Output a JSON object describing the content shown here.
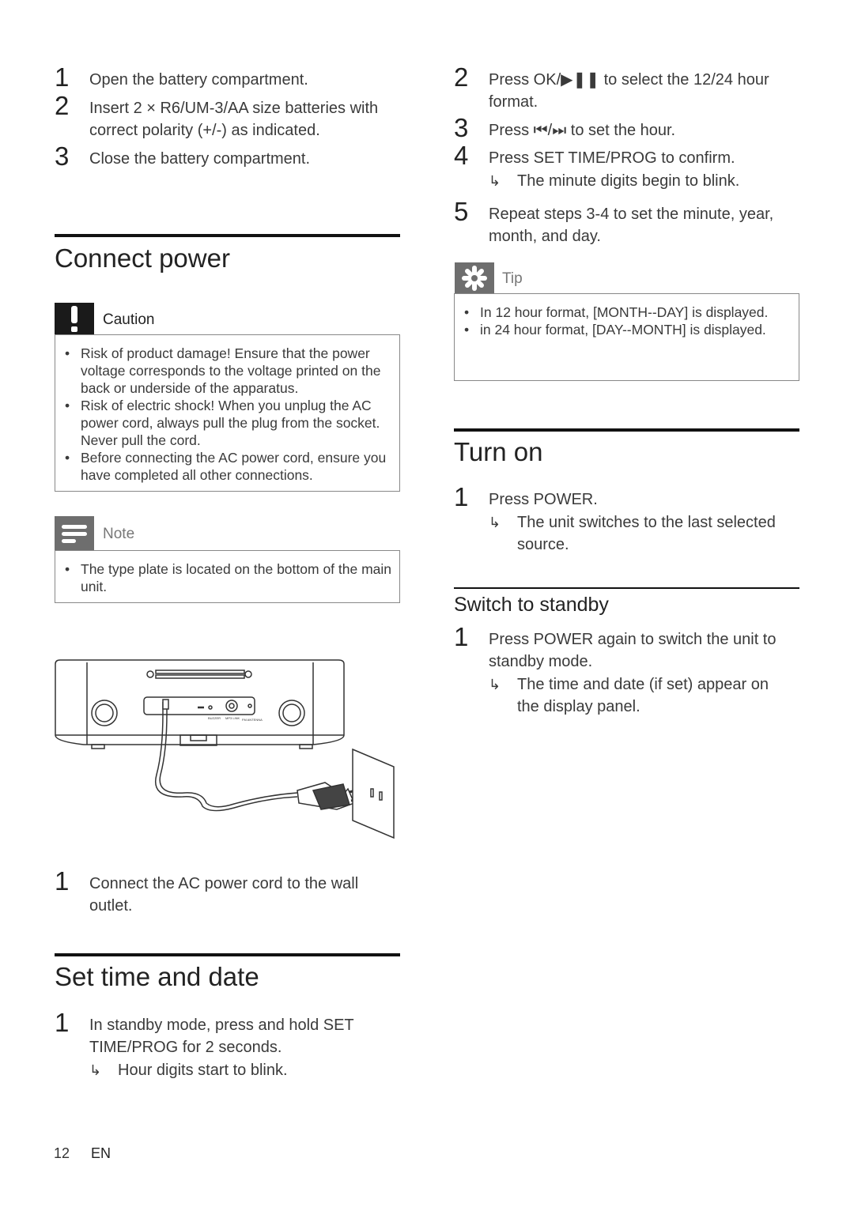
{
  "left": {
    "battery_steps": [
      {
        "num": "1",
        "text": "Open the battery compartment."
      },
      {
        "num": "2",
        "text": "Insert 2 × R6/UM-3/AA size batteries with correct polarity (+/-) as indicated."
      },
      {
        "num": "3",
        "text": "Close the battery compartment."
      }
    ],
    "connect_power": {
      "title": "Connect power",
      "caution": {
        "label": "Caution",
        "icon": "exclamation-icon",
        "items": [
          "Risk of product damage! Ensure that the power voltage corresponds to the voltage printed on the back or underside of the apparatus.",
          "Risk of electric shock! When you unplug the AC power cord, always pull the plug from the socket. Never pull the cord.",
          "Before connecting the AC power cord, ensure you have completed all other connections."
        ]
      },
      "note": {
        "label": "Note",
        "icon": "note-lines-icon",
        "items": [
          "The type plate is located on the bottom of the main unit."
        ]
      },
      "illustration_labels": {
        "buzzer": "BUZZER",
        "mp3": "MP3 LINK",
        "fm": "FM ANTENNA"
      },
      "step": {
        "num": "1",
        "text": "Connect the AC power cord to the wall outlet."
      }
    },
    "set_time": {
      "title": "Set time and date",
      "step": {
        "num": "1",
        "text": "In standby mode, press and hold SET TIME/PROG for 2 seconds."
      },
      "result": "Hour digits start to blink."
    },
    "footer": {
      "page": "12",
      "lang": "EN"
    }
  },
  "right": {
    "steps": [
      {
        "num": "2",
        "text": "Press OK/▶❚❚ to select the 12/24 hour format."
      },
      {
        "num": "3",
        "text": "Press ⏮/⏭ to set the hour."
      },
      {
        "num": "4",
        "text": "Press SET TIME/PROG to confirm."
      },
      {
        "num": "5",
        "text": "Repeat steps 3-4 to set the minute, year, month, and day."
      }
    ],
    "step4_result": "The minute digits begin to blink.",
    "tip": {
      "label": "Tip",
      "icon": "asterisk-icon",
      "items": [
        "In 12 hour format, [MONTH--DAY] is displayed.",
        "in 24 hour format, [DAY--MONTH] is displayed."
      ]
    },
    "turn_on": {
      "title": "Turn on",
      "step": {
        "num": "1",
        "text": "Press POWER."
      },
      "result": "The unit switches to the last selected source."
    },
    "standby": {
      "title": "Switch to standby",
      "step": {
        "num": "1",
        "text": "Press POWER again to switch the unit to standby mode."
      },
      "result": "The time and date (if set) appear on the display panel."
    },
    "arrow_glyph": "↳"
  }
}
